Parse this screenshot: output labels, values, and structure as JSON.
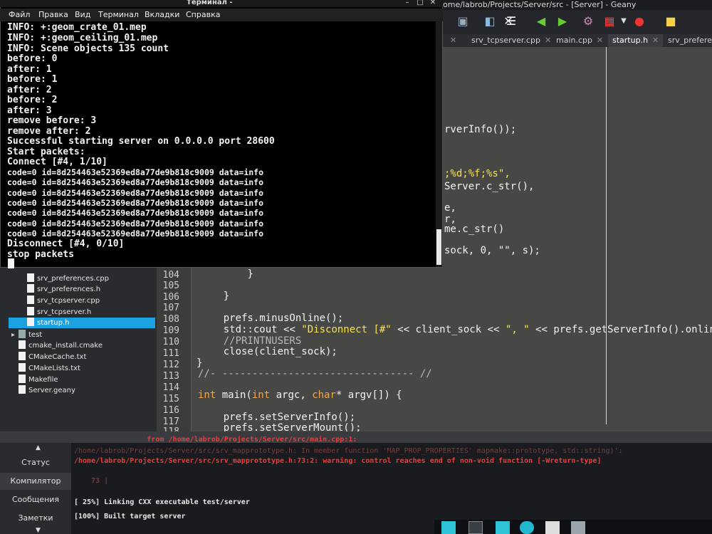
{
  "geany": {
    "title": "ome/labrob/Projects/Server/src - [Server] - Geany",
    "tabs": [
      {
        "label": "srv_tcpserver.cpp",
        "active": false
      },
      {
        "label": "main.cpp",
        "active": false
      },
      {
        "label": "startup.h",
        "active": true
      },
      {
        "label": "srv_preferen",
        "active": false
      }
    ],
    "toolbar_icons": [
      "open-icon",
      "save-icon",
      "save-all-icon",
      "close-icon",
      "back-icon",
      "forward-icon",
      "compile-icon",
      "build-icon",
      "dropdown-icon",
      "stop-icon",
      "color-icon"
    ],
    "code_lines": [
      {
        "text": "rverInfo());",
        "kind": "plain"
      },
      {
        "text": ";%d;%f;%s\",",
        "kind": "string"
      },
      {
        "text": "Server.c_str(),",
        "kind": "plain"
      },
      {
        "text": "e,",
        "kind": "plain"
      },
      {
        "text": "r,",
        "kind": "plain"
      },
      {
        "text": "me.c_str()",
        "kind": "plain"
      },
      {
        "text": "sock, 0, \"\", s);",
        "kind": "call"
      }
    ],
    "editor_lines": [
      {
        "num": "104",
        "text": "        }"
      },
      {
        "num": "105",
        "text": ""
      },
      {
        "num": "106",
        "text": "    }"
      },
      {
        "num": "107",
        "text": ""
      },
      {
        "num": "108",
        "text": "    prefs.minusOnline();"
      },
      {
        "num": "109",
        "text": "    std::cout << \"Disconnect [#\" << client_sock << \", \" << prefs.getServerInfo().online <<"
      },
      {
        "num": "110",
        "text": "    //PRINTNUSERS"
      },
      {
        "num": "111",
        "text": "    close(client_sock);"
      },
      {
        "num": "112",
        "text": "}"
      },
      {
        "num": "113",
        "text": "//- -------------------------------- //"
      },
      {
        "num": "114",
        "text": ""
      },
      {
        "num": "115",
        "text": "int main(int argc, char* argv[]) {"
      },
      {
        "num": "116",
        "text": ""
      },
      {
        "num": "117",
        "text": "    prefs.setServerInfo();"
      },
      {
        "num": "118",
        "text": "    prefs.setServerMount();"
      }
    ]
  },
  "sidebar": {
    "items": [
      {
        "label": "srv_preferences.cpp",
        "selected": false
      },
      {
        "label": "srv_preferences.h",
        "selected": false
      },
      {
        "label": "srv_tcpserver.cpp",
        "selected": false
      },
      {
        "label": "srv_tcpserver.h",
        "selected": false
      },
      {
        "label": "startup.h",
        "selected": true
      },
      {
        "label": "test",
        "selected": false
      },
      {
        "label": "cmake_install.cmake",
        "selected": false
      },
      {
        "label": "CMakeCache.txt",
        "selected": false
      },
      {
        "label": "CMakeLists.txt",
        "selected": false
      },
      {
        "label": "Makefile",
        "selected": false
      },
      {
        "label": "Server.geany",
        "selected": false
      }
    ]
  },
  "messages": {
    "tabs": [
      {
        "label": "Статус",
        "active": false
      },
      {
        "label": "Компилятор",
        "active": true
      },
      {
        "label": "Сообщения",
        "active": false
      },
      {
        "label": "Заметки",
        "active": false
      }
    ],
    "lines": [
      {
        "text": "                 from /home/labrob/Projects/Server/src/main.cpp:1:",
        "style": "red"
      },
      {
        "text": "/home/labrob/Projects/Server/src/srv_mapprototype.h: In member function 'MAP_PROP_PROPERTIES' mapmake::prototype, std::string)':",
        "style": "dim"
      },
      {
        "text": "/home/labrob/Projects/Server/src/srv_mapprototype.h:73:2: warning: control reaches end of non-void function [-Wreturn-type]",
        "style": "red"
      },
      {
        "text": "    73 |",
        "style": "dim"
      },
      {
        "text": "[ 25%] Linking CXX executable test/server",
        "style": "white"
      },
      {
        "text": "[100%] Built target server",
        "style": "white"
      }
    ]
  },
  "terminal": {
    "title": "Терминал -",
    "menu": [
      "Файл",
      "Правка",
      "Вид",
      "Терминал",
      "Вкладки",
      "Справка"
    ],
    "lines": [
      "INFO: +:geom_crate_01.mep",
      "INFO: +:geom_ceiling_01.mep",
      "INFO: Scene objects 135 count",
      "before: 0",
      "after: 1",
      "before: 1",
      "after: 2",
      "before: 2",
      "after: 3",
      "remove before: 3",
      "remove after: 2",
      "Successful starting server on 0.0.0.0 port 28600",
      "Start packets:",
      "Connect [#4, 1/10]",
      "code=0 id=8d254463e52369ed8a77de9b818c9009 data=info",
      "code=0 id=8d254463e52369ed8a77de9b818c9009 data=info",
      "code=0 id=8d254463e52369ed8a77de9b818c9009 data=info",
      "code=0 id=8d254463e52369ed8a77de9b818c9009 data=info",
      "code=0 id=8d254463e52369ed8a77de9b818c9009 data=info",
      "code=0 id=8d254463e52369ed8a77de9b818c9009 data=info",
      "code=0 id=8d254463e52369ed8a77de9b818c9009 data=info",
      "Disconnect [#4, 0/10]",
      "stop packets"
    ]
  },
  "colors": {
    "selection": "#1aa3e0",
    "keyword": "#f0a64a",
    "string": "#f7e34f",
    "error": "#f03a3a"
  }
}
